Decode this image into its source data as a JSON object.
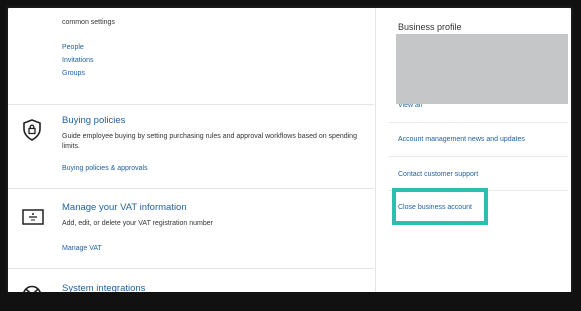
{
  "top_section": {
    "description": "common settings",
    "links": [
      "People",
      "Invitations",
      "Groups"
    ]
  },
  "buying_policies": {
    "title": "Buying policies",
    "description": "Guide employee buying by setting purchasing rules and approval workflows based on spending limits.",
    "link": "Buying policies & approvals"
  },
  "vat": {
    "title": "Manage your VAT information",
    "description": "Add, edit, or delete your VAT registration number",
    "link": "Manage VAT"
  },
  "system_integrations": {
    "title": "System integrations"
  },
  "sidebar": {
    "title": "Business profile",
    "view_all": "View all",
    "items": [
      "Account management news and updates",
      "Contact customer support",
      "Close business account"
    ]
  },
  "colors": {
    "link": "#2162a1",
    "highlight": "#2bbfb0",
    "placeholder": "#c5c6c7"
  }
}
